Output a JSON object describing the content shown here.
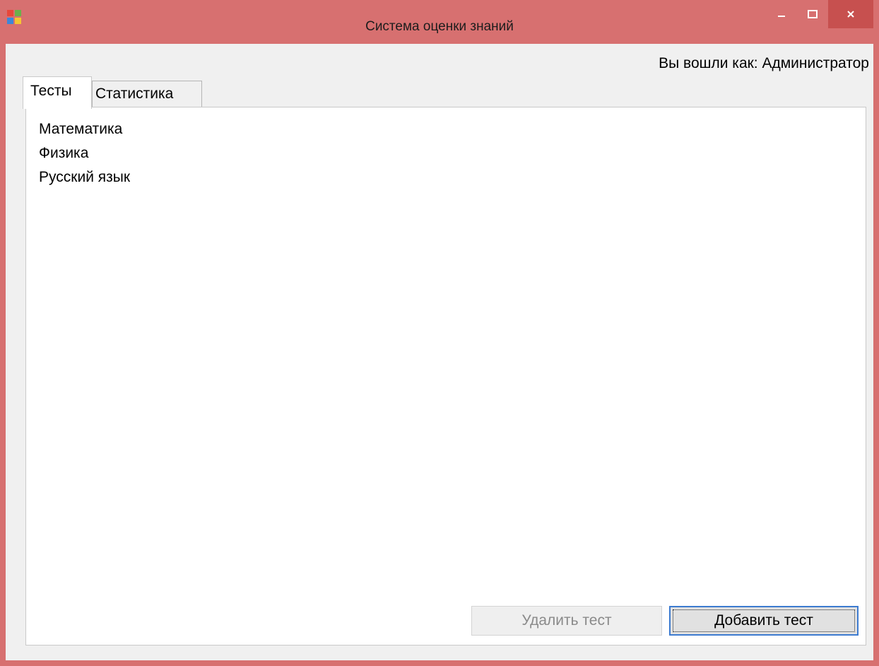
{
  "window": {
    "title": "Система оценки знаний",
    "icon": "app-icon",
    "accent_color": "#d77070"
  },
  "header": {
    "user_label": "Вы вошли как: Администратор"
  },
  "tabs": [
    {
      "label": "Тесты",
      "selected": true
    },
    {
      "label": "Статистика",
      "selected": false
    }
  ],
  "tests": {
    "items": [
      "Математика",
      "Физика",
      "Русский язык"
    ],
    "delete_label": "Удалить тест",
    "delete_enabled": false,
    "add_label": "Добавить тест"
  }
}
